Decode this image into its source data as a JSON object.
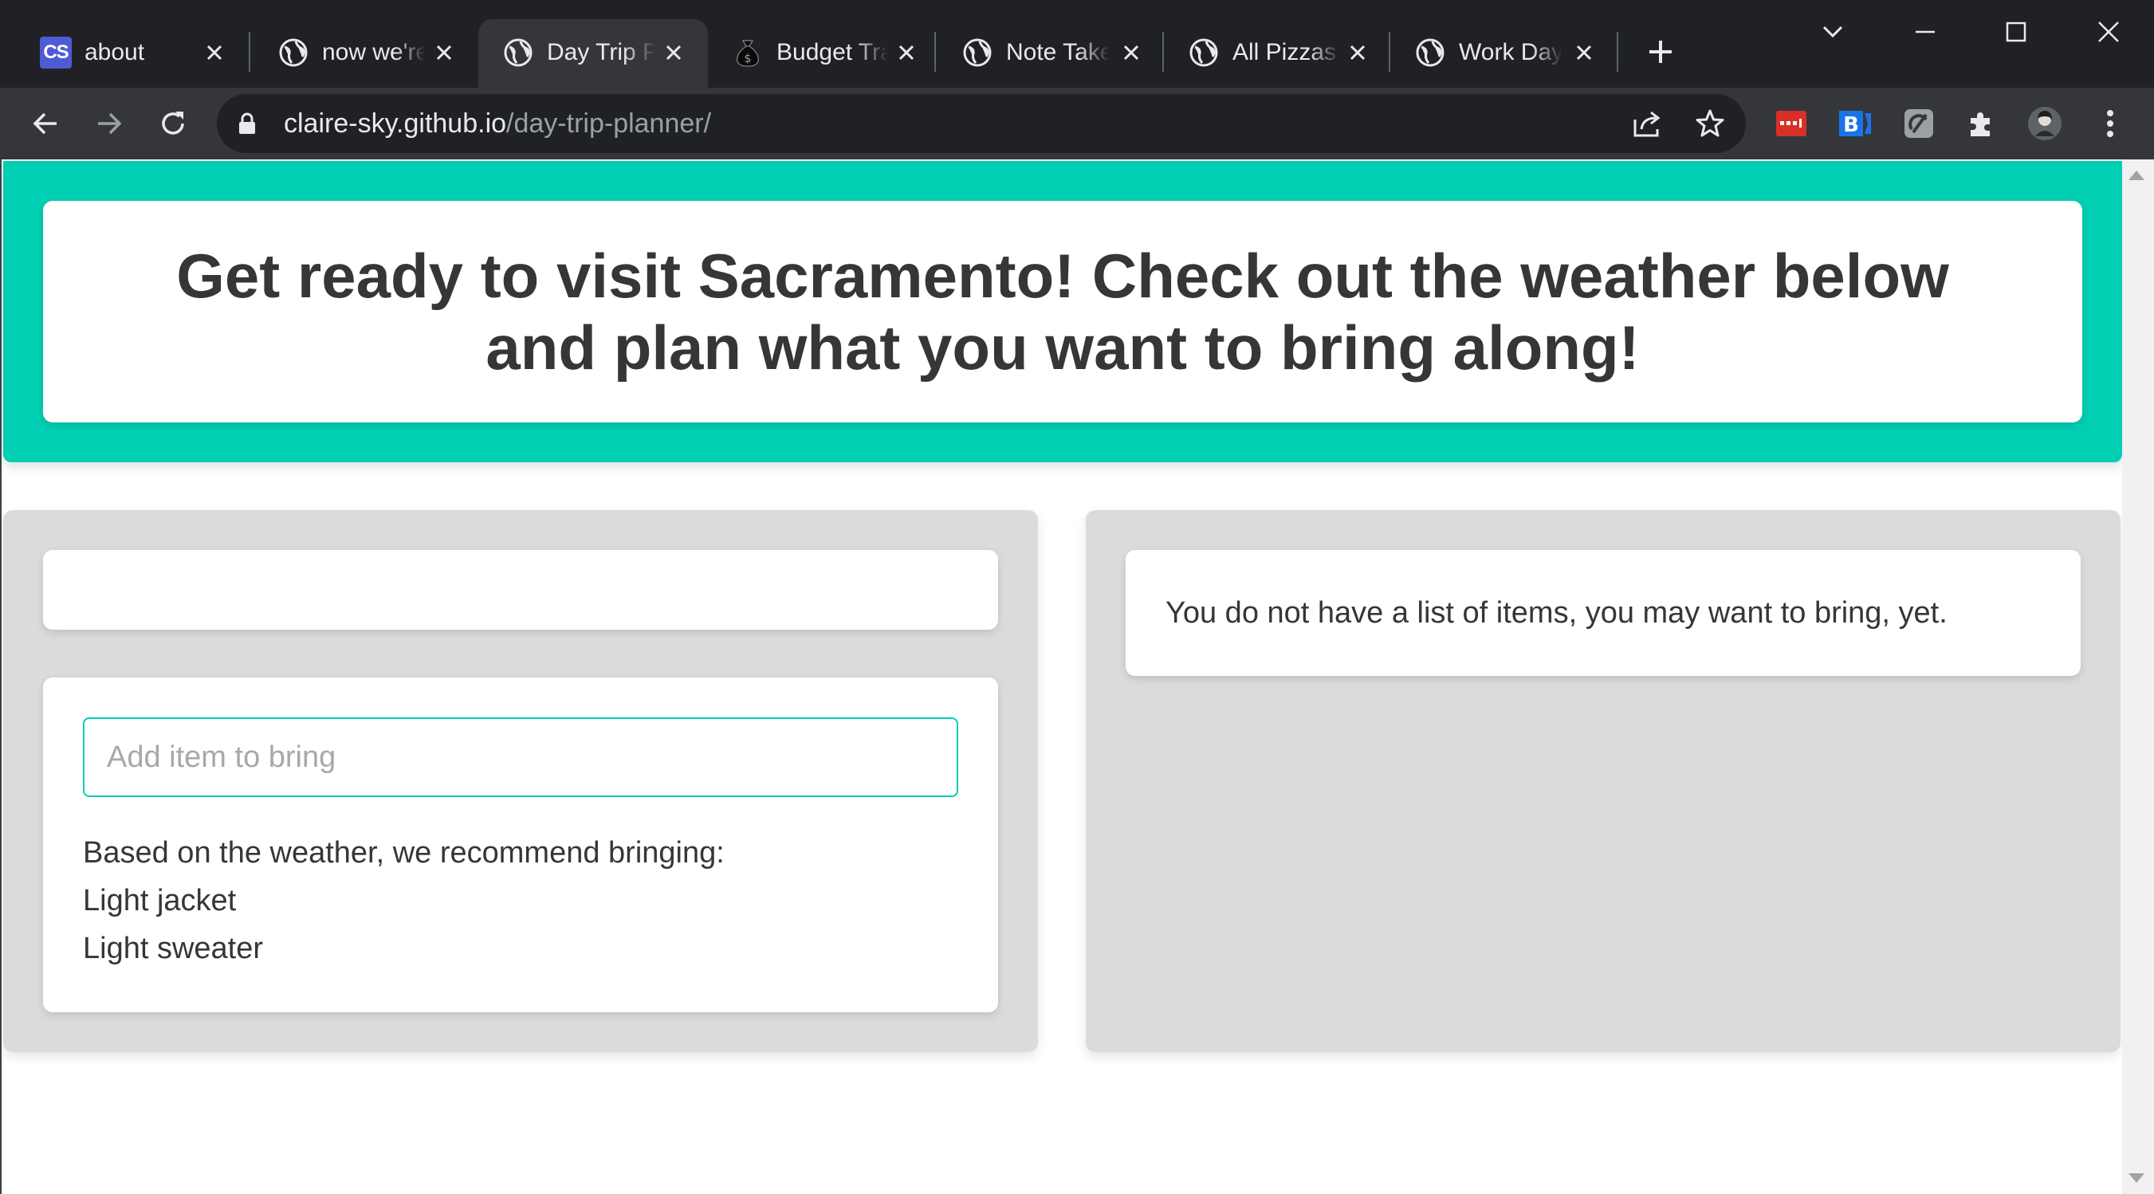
{
  "tabs": [
    {
      "title": "about",
      "icon": "cs-logo-icon",
      "badge": "CS",
      "active": false
    },
    {
      "title": "now we're",
      "icon": "globe-icon",
      "active": false
    },
    {
      "title": "Day Trip Planner",
      "icon": "globe-icon",
      "active": true
    },
    {
      "title": "Budget Tracker",
      "icon": "money-bag-icon",
      "active": false
    },
    {
      "title": "Note Taker",
      "icon": "globe-icon",
      "active": false
    },
    {
      "title": "All Pizzas",
      "icon": "globe-icon",
      "active": false
    },
    {
      "title": "Work Day",
      "icon": "globe-icon",
      "active": false
    }
  ],
  "address_bar": {
    "domain": "claire-sky.github.io",
    "path": "/day-trip-planner/"
  },
  "page": {
    "heading": "Get ready to visit Sacramento! Check out the weather below and plan what you want to bring along!",
    "weather_text": "",
    "input_placeholder": "Add item to bring",
    "input_value": "",
    "recommend_intro": "Based on the weather, we recommend bringing:",
    "recommendations": [
      "Light jacket",
      "Light sweater"
    ],
    "empty_list_message": "You do not have a list of items, you may want to bring, yet."
  },
  "colors": {
    "accent": "#00cfb4",
    "panel": "#dbdbdb",
    "chrome_dark": "#202124",
    "chrome_toolbar": "#35363a"
  }
}
